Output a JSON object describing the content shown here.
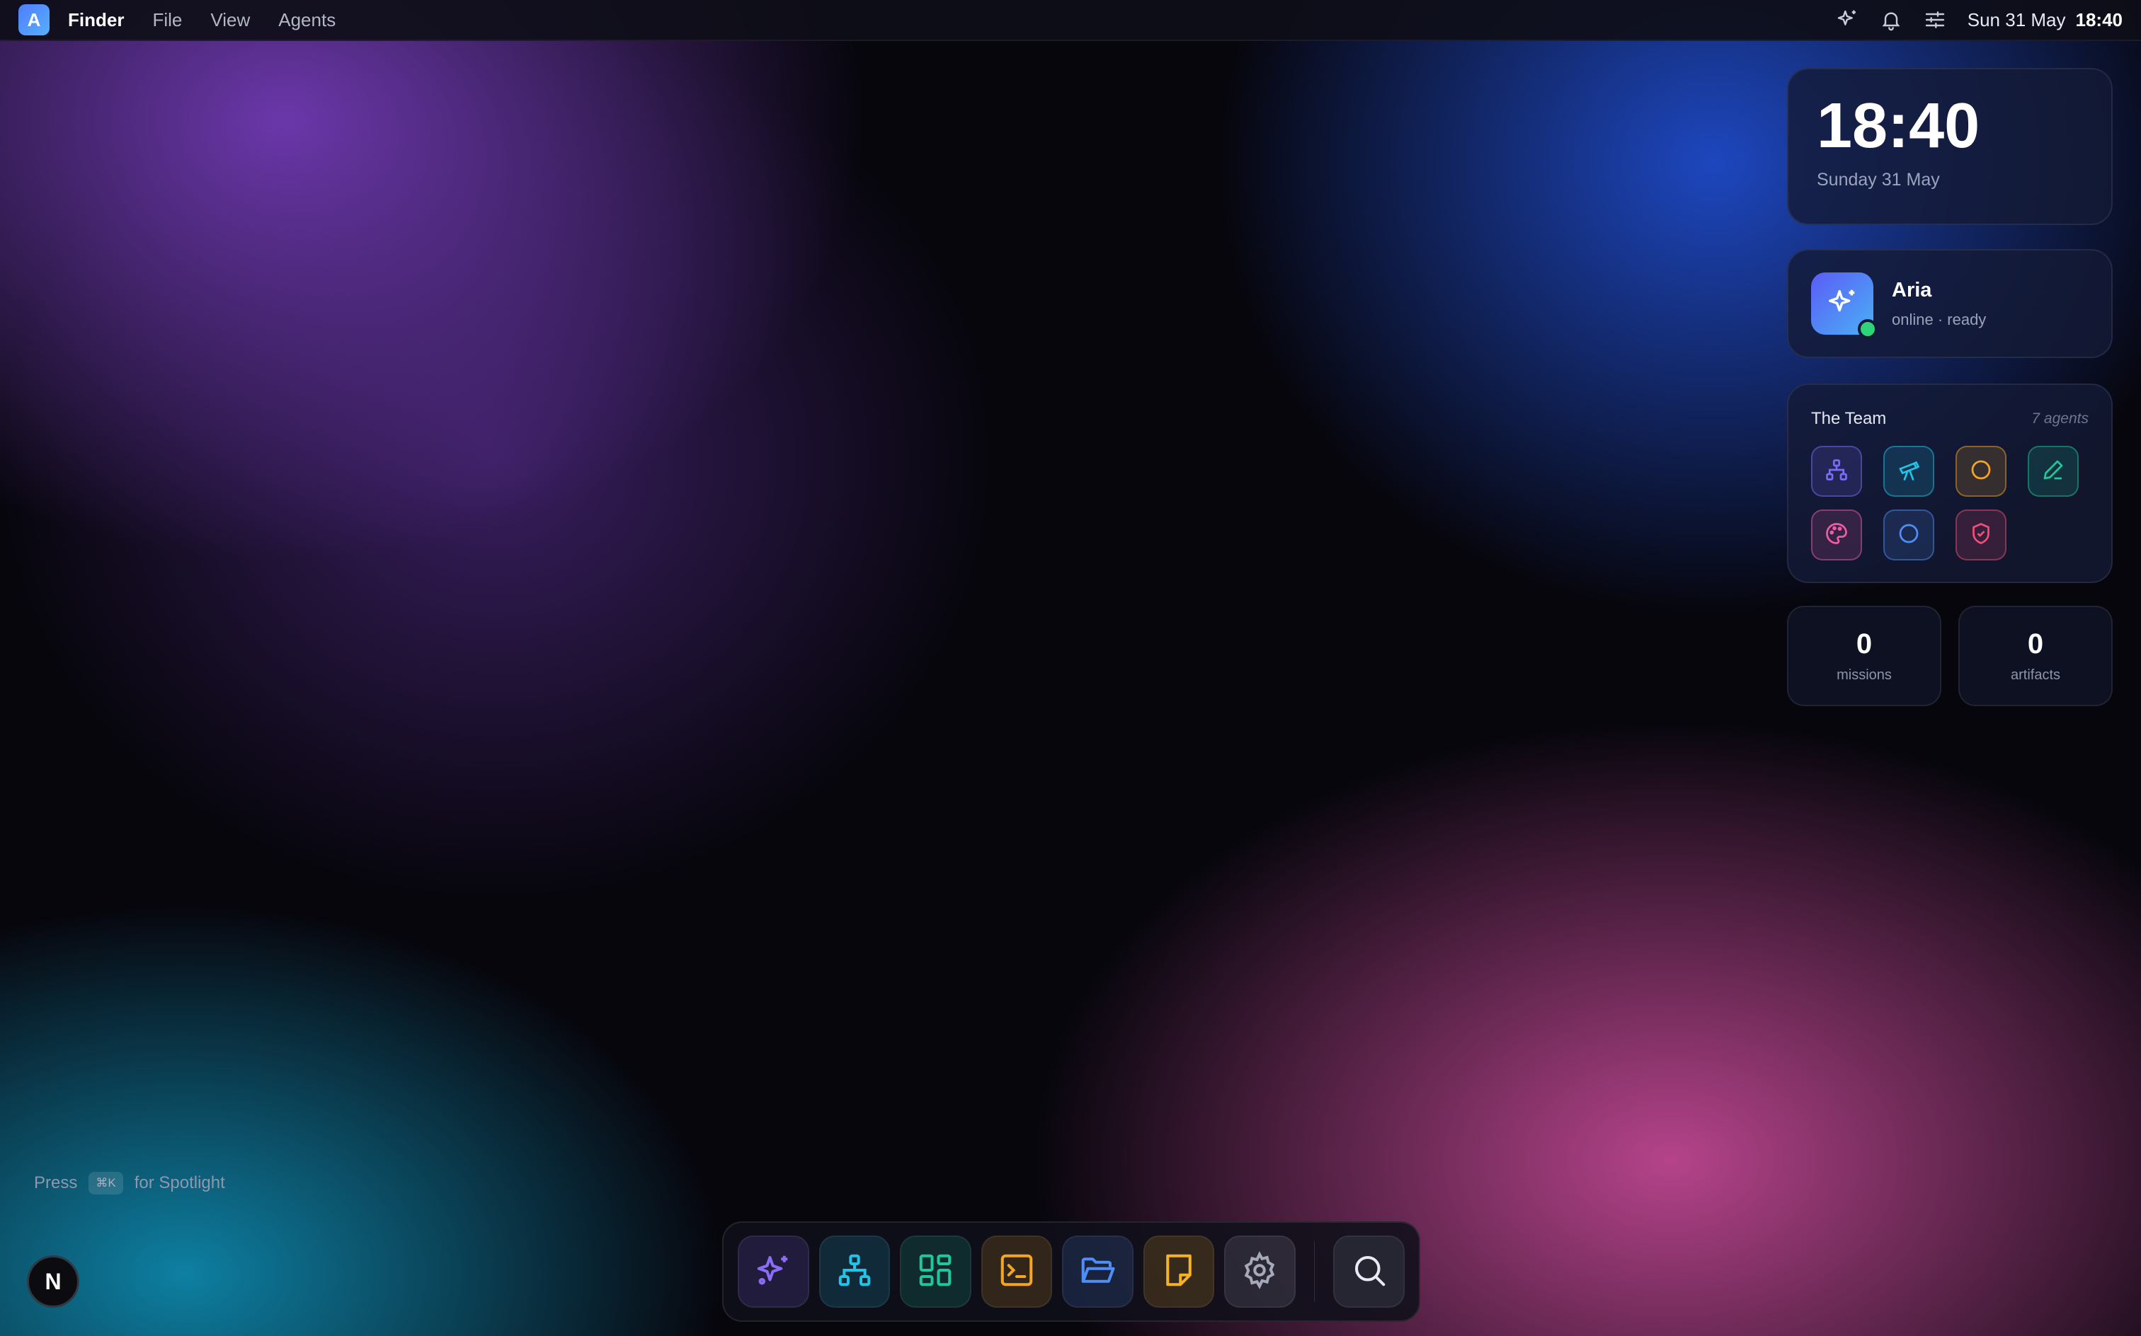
{
  "menubar": {
    "app_letter": "A",
    "app_name": "Finder",
    "menus": [
      "File",
      "View",
      "Agents"
    ],
    "status_icons": [
      "sparkles-icon",
      "bell-icon",
      "sliders-icon"
    ],
    "date": "Sun 31 May",
    "time": "18:40"
  },
  "clock": {
    "time": "18:40",
    "date": "Sunday 31 May"
  },
  "assistant": {
    "name": "Aria",
    "status": "online · ready",
    "icon": "sparkles-icon",
    "online": true
  },
  "team": {
    "title": "The Team",
    "count": "7 agents",
    "agents": [
      {
        "icon": "org-chart-icon",
        "color": "#7c6cf6"
      },
      {
        "icon": "telescope-icon",
        "color": "#22c3e6"
      },
      {
        "icon": "circle-icon",
        "color": "#f5a524"
      },
      {
        "icon": "pen-icon",
        "color": "#1fc79a"
      },
      {
        "icon": "palette-icon",
        "color": "#ec5fa6"
      },
      {
        "icon": "circle-icon",
        "color": "#4f8ef7"
      },
      {
        "icon": "shield-check-icon",
        "color": "#f0507a"
      }
    ]
  },
  "stats": {
    "missions": {
      "value": "0",
      "label": "missions"
    },
    "artifacts": {
      "value": "0",
      "label": "artifacts"
    }
  },
  "spotlight_hint": {
    "prefix": "Press",
    "shortcut": "⌘K",
    "suffix": "for Spotlight"
  },
  "corner_badge": "N",
  "dock": {
    "items": [
      {
        "icon": "sparkles-icon",
        "color": "#8b6cf7"
      },
      {
        "icon": "org-chart-icon",
        "color": "#22c3e6"
      },
      {
        "icon": "grid-icon",
        "color": "#1fc79a"
      },
      {
        "icon": "terminal-icon",
        "color": "#f5a524"
      },
      {
        "icon": "folder-open-icon",
        "color": "#4f8ef7"
      },
      {
        "icon": "note-icon",
        "color": "#f5b324"
      },
      {
        "icon": "gear-icon",
        "color": "#a5a9b8"
      }
    ],
    "search_icon": "search-icon"
  }
}
